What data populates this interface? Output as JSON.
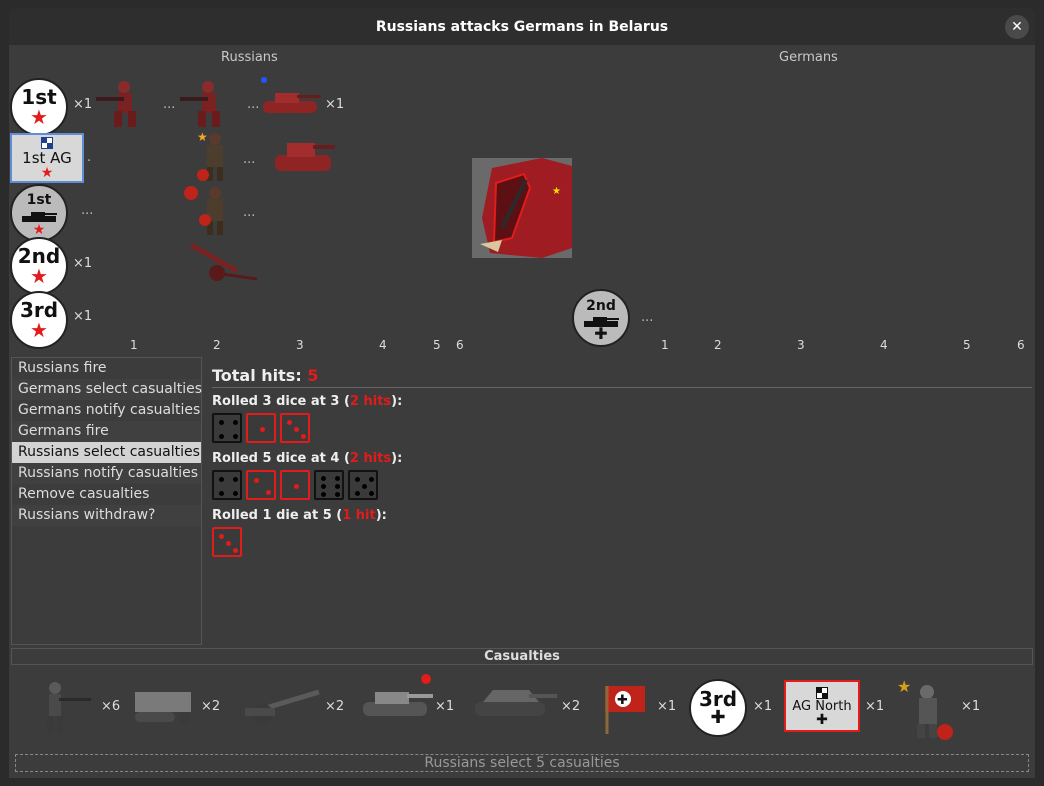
{
  "window": {
    "title": "Russians attacks Germans in Belarus",
    "close_glyph": "✕"
  },
  "sides": {
    "attacker": "Russians",
    "defender": "Germans"
  },
  "attacker_units": [
    {
      "label": "1st",
      "count": "×1"
    },
    {
      "label": "1st AG",
      "count": ""
    },
    {
      "label": "1st",
      "count": ""
    },
    {
      "label": "2nd",
      "count": "×1"
    },
    {
      "label": "3rd",
      "count": "×1"
    }
  ],
  "tank_count": "×1",
  "defender_unit": {
    "label": "2nd"
  },
  "ellipsis": "...",
  "ruler_left": [
    "1",
    "2",
    "3",
    "4",
    "5",
    "6"
  ],
  "ruler_right": [
    "1",
    "2",
    "3",
    "4",
    "5",
    "6"
  ],
  "steps": [
    "Russians fire",
    "Germans select casualties",
    "Germans notify casualties",
    "Germans fire",
    "Russians select casualties",
    "Russians notify casualties",
    "Remove casualties",
    "Russians withdraw?"
  ],
  "selected_step": 4,
  "hits": {
    "total_label": "Total hits:",
    "total": "5",
    "rolls": [
      {
        "text": "Rolled 3 dice at 3 (",
        "hits": "2 hits",
        "close": "):"
      },
      {
        "text": "Rolled 5 dice at 4 (",
        "hits": "2 hits",
        "close": "):"
      },
      {
        "text": "Rolled 1 die at 5 (",
        "hits": "1 hit",
        "close": "):"
      }
    ]
  },
  "dice_values": [
    [
      4,
      1,
      3
    ],
    [
      4,
      2,
      1,
      6,
      5
    ],
    [
      3
    ]
  ],
  "dice_hit": [
    [
      false,
      true,
      true
    ],
    [
      false,
      true,
      true,
      false,
      false
    ],
    [
      true
    ]
  ],
  "casualties": {
    "header": "Casualties",
    "items": [
      {
        "icon": "infantry-icon",
        "count": "×6"
      },
      {
        "icon": "halftrack-icon",
        "count": "×2"
      },
      {
        "icon": "artillery-icon",
        "count": "×2"
      },
      {
        "icon": "tank-icon",
        "count": "×1"
      },
      {
        "icon": "tank-destroyer-icon",
        "count": "×2"
      },
      {
        "icon": "flag-icon",
        "count": "×1"
      },
      {
        "icon": "3rd",
        "count": "×1"
      },
      {
        "icon": "AG North",
        "count": "×1"
      },
      {
        "icon": "officer-icon",
        "count": "×1"
      }
    ]
  },
  "status": "Russians select 5 casualties",
  "colors": {
    "hit": "#e21b1b",
    "accent_border": "#5f8dd6"
  }
}
